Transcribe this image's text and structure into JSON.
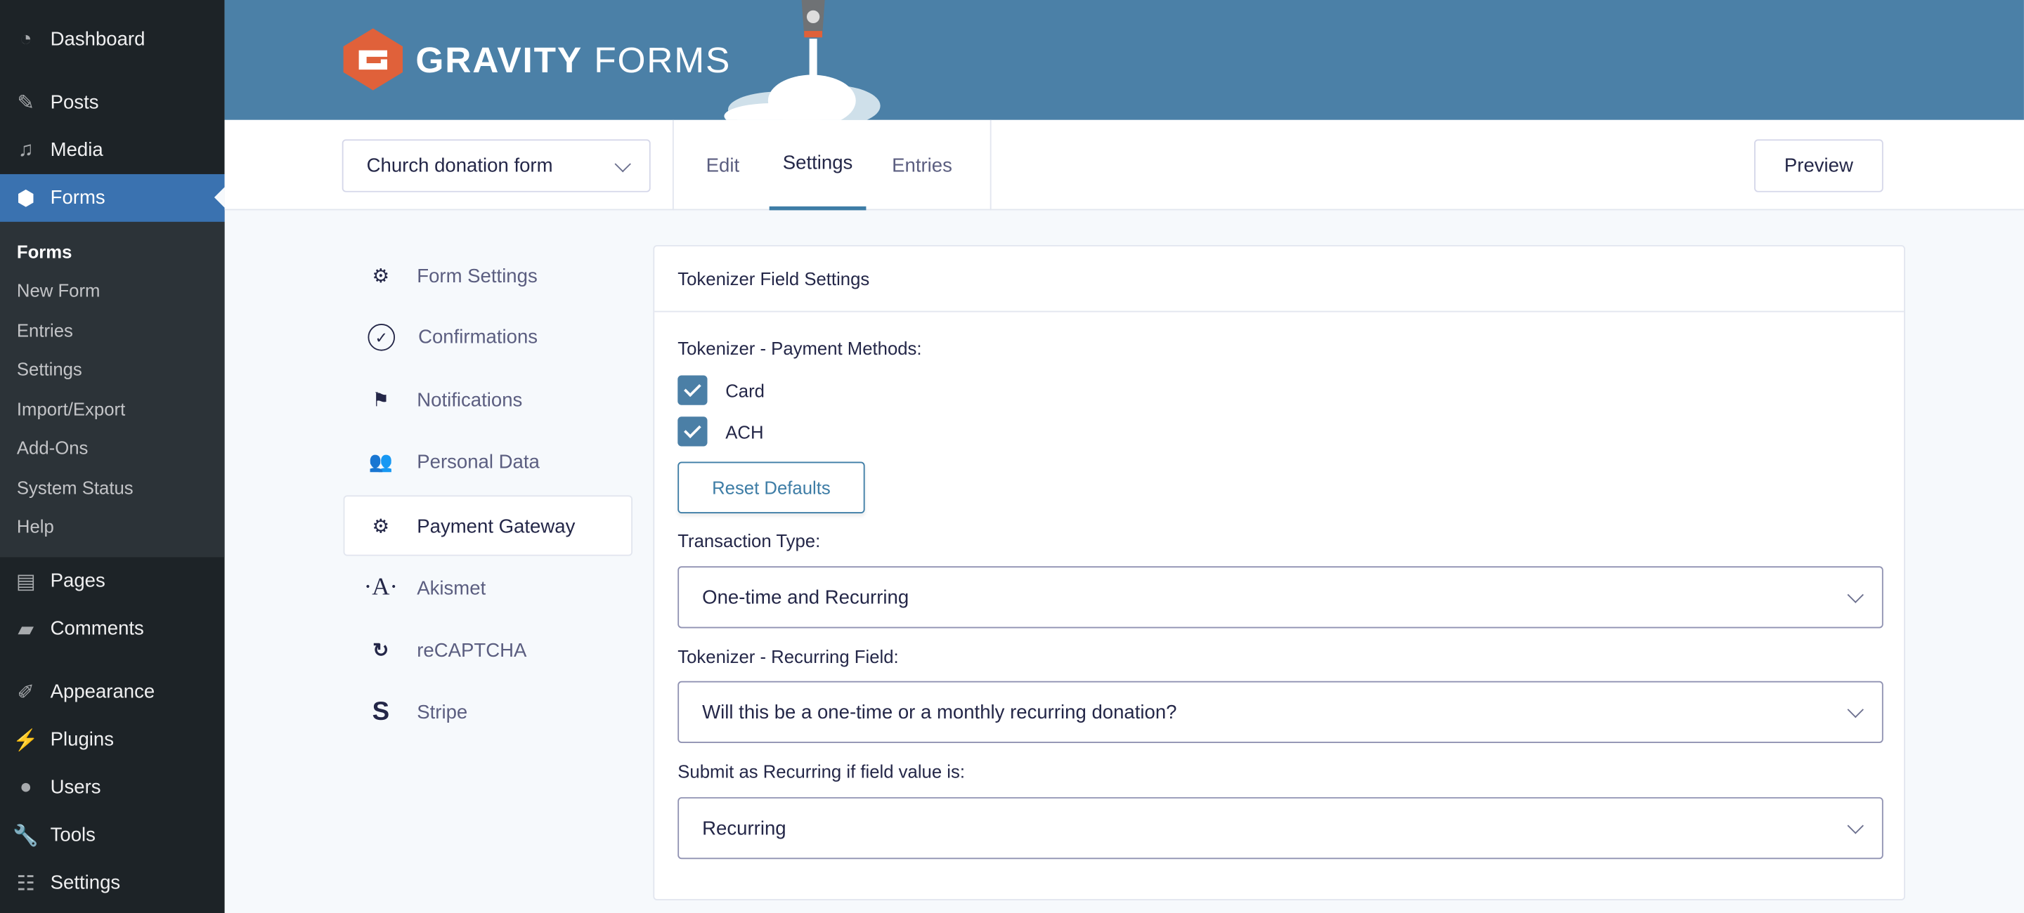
{
  "sidebar": {
    "items": [
      {
        "label": "Dashboard",
        "icon": "dashboard-icon"
      },
      {
        "label": "Posts",
        "icon": "pin-icon"
      },
      {
        "label": "Media",
        "icon": "media-icon"
      },
      {
        "label": "Forms",
        "icon": "gravity-forms-icon"
      },
      {
        "label": "Pages",
        "icon": "pages-icon"
      },
      {
        "label": "Comments",
        "icon": "comment-icon"
      },
      {
        "label": "Appearance",
        "icon": "brush-icon"
      },
      {
        "label": "Plugins",
        "icon": "plugin-icon"
      },
      {
        "label": "Users",
        "icon": "user-icon"
      },
      {
        "label": "Tools",
        "icon": "wrench-icon"
      },
      {
        "label": "Settings",
        "icon": "settings-icon"
      }
    ],
    "submenu": [
      "Forms",
      "New Form",
      "Entries",
      "Settings",
      "Import/Export",
      "Add-Ons",
      "System Status",
      "Help"
    ]
  },
  "header": {
    "logo_text_bold": "GRAVITY",
    "logo_text_light": "FORMS"
  },
  "toolbar": {
    "form_select": "Church donation form",
    "tabs": [
      "Edit",
      "Settings",
      "Entries"
    ],
    "active_tab": "Settings",
    "preview": "Preview"
  },
  "settings_nav": [
    {
      "label": "Form Settings",
      "icon": "gear-icon"
    },
    {
      "label": "Confirmations",
      "icon": "check-circle-icon"
    },
    {
      "label": "Notifications",
      "icon": "flag-icon"
    },
    {
      "label": "Personal Data",
      "icon": "users-icon"
    },
    {
      "label": "Payment Gateway",
      "icon": "gear-icon"
    },
    {
      "label": "Akismet",
      "icon": "akismet-icon"
    },
    {
      "label": "reCAPTCHA",
      "icon": "recaptcha-icon"
    },
    {
      "label": "Stripe",
      "icon": "stripe-icon"
    }
  ],
  "panel": {
    "title": "Tokenizer Field Settings",
    "payment_methods_label": "Tokenizer - Payment Methods:",
    "methods": [
      {
        "label": "Card",
        "checked": true
      },
      {
        "label": "ACH",
        "checked": true
      }
    ],
    "reset": "Reset Defaults",
    "transaction_label": "Transaction Type:",
    "transaction_value": "One-time and Recurring",
    "recurring_field_label": "Tokenizer - Recurring Field:",
    "recurring_field_value": "Will this be a one-time or a monthly recurring donation?",
    "submit_label": "Submit as Recurring if field value is:",
    "submit_value": "Recurring"
  },
  "colors": {
    "accent": "#4b7fa6",
    "sidebar": "#1d2327",
    "active_menu": "#3a72b0",
    "logo": "#e0613a"
  }
}
